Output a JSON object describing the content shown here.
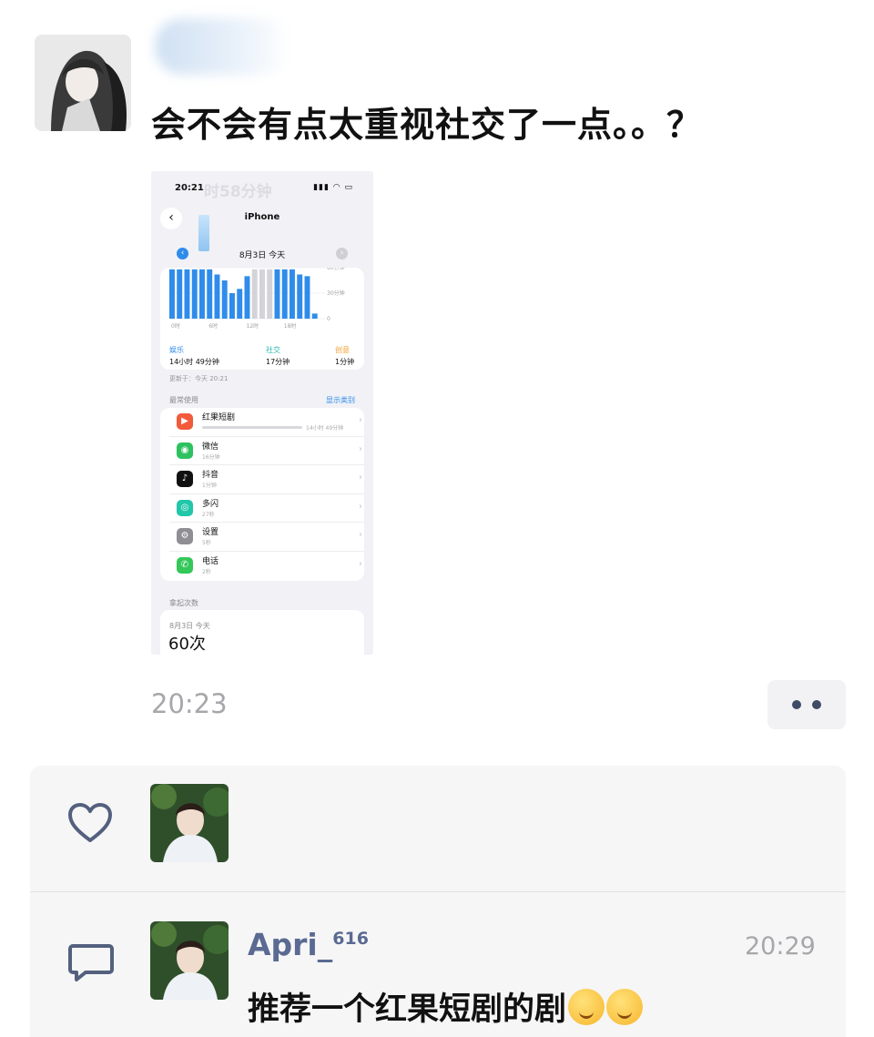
{
  "post": {
    "author_name": "",
    "text": "会不会有点太重视社交了一点。。？",
    "time": "20:23"
  },
  "screenshot": {
    "ghost_text": "时58分钟",
    "status_time": "20:21",
    "status_icons": "▮▮▮ ◠ ▭",
    "nav_title": "iPhone",
    "date": "8月3日 今天",
    "hour_labels": [
      "0时",
      "6时",
      "12时",
      "18时"
    ],
    "y_labels": [
      "60分钟",
      "30分钟",
      "0"
    ],
    "hourly_minutes": [
      58,
      58,
      58,
      58,
      58,
      58,
      52,
      45,
      30,
      35,
      50,
      58,
      58,
      58,
      58,
      58,
      58,
      52,
      50,
      6
    ],
    "hourly_colors": [
      "#2f8ceb",
      "#2f8ceb",
      "#2f8ceb",
      "#2f8ceb",
      "#2f8ceb",
      "#2f8ceb",
      "#2f8ceb",
      "#2f8ceb",
      "#2f8ceb",
      "#2f8ceb",
      "#2f8ceb",
      "#d3d3d8",
      "#d3d3d8",
      "#d3d3d8",
      "#2f8ceb",
      "#2f8ceb",
      "#2f8ceb",
      "#2f8ceb",
      "#2f8ceb",
      "#2f8ceb"
    ],
    "categories": [
      {
        "name": "娱乐",
        "time": "14小时 49分钟",
        "color": "#2f8ceb"
      },
      {
        "name": "社交",
        "time": "17分钟",
        "color": "#2fb8ae"
      },
      {
        "name": "创意",
        "time": "1分钟",
        "color": "#f0a030"
      }
    ],
    "updated": "更新于：今天 20:21",
    "most_used_label": "最常使用",
    "show_categories": "显示类别",
    "apps": [
      {
        "name": "红果短剧",
        "time": "14小时 49分钟",
        "icon": "▶",
        "color": "#f25a3c"
      },
      {
        "name": "微信",
        "time": "16分钟",
        "icon": "◉",
        "color": "#2dc160"
      },
      {
        "name": "抖音",
        "time": "1分钟",
        "icon": "♪",
        "color": "#111111"
      },
      {
        "name": "多闪",
        "time": "27秒",
        "icon": "◎",
        "color": "#22c7a9"
      },
      {
        "name": "设置",
        "time": "5秒",
        "icon": "⚙",
        "color": "#8e8e93"
      },
      {
        "name": "电话",
        "time": "2秒",
        "icon": "✆",
        "color": "#34c759"
      }
    ],
    "pickups_label": "拿起次数",
    "pickups_date": "8月3日 今天",
    "pickups_value": "60次"
  },
  "interactions": {
    "comment": {
      "author": "Apri_",
      "author_sup": "616",
      "time": "20:29",
      "text": "推荐一个红果短剧的剧"
    }
  },
  "icons": [
    "heart-icon",
    "comment-icon",
    "more-icon",
    "back-icon"
  ]
}
